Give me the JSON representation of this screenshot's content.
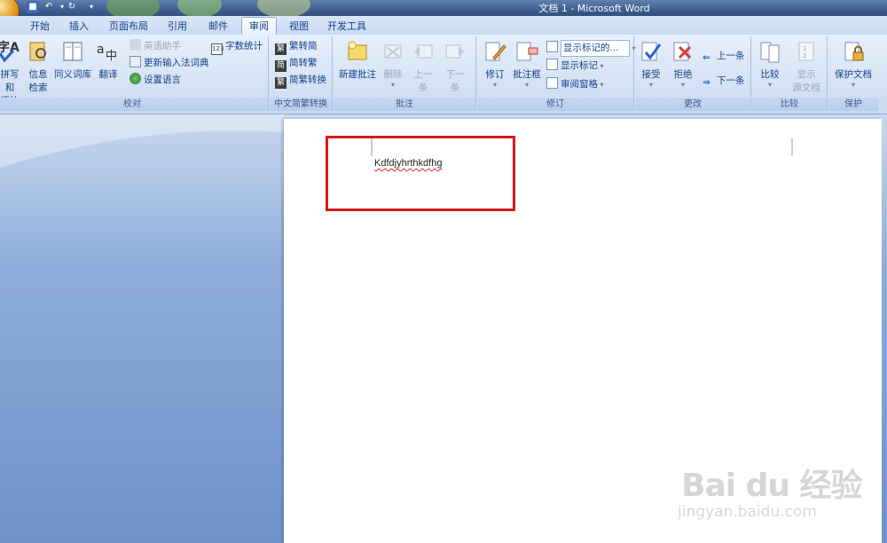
{
  "window": {
    "title": "文档 1 - Microsoft Word"
  },
  "tabs": [
    {
      "label": "开始"
    },
    {
      "label": "插入"
    },
    {
      "label": "页面布局"
    },
    {
      "label": "引用"
    },
    {
      "label": "邮件"
    },
    {
      "label": "审阅",
      "active": true
    },
    {
      "label": "视图"
    },
    {
      "label": "开发工具"
    }
  ],
  "ribbon": {
    "proofing": {
      "label": "校对",
      "spelling_label_1": "拼写和",
      "spelling_label_2": "语法",
      "research_label_1": "信息",
      "research_label_2": "检索",
      "thesaurus_label": "同义词库",
      "translate_label": "翻译",
      "english_assistant": "英语助手",
      "update_ime": "更新输入法词典",
      "set_language": "设置语言",
      "word_count": "字数统计"
    },
    "chinese_conversion": {
      "label": "中文简繁转换",
      "to_simplified": "繁转简",
      "to_traditional": "简转繁",
      "convert": "简繁转换"
    },
    "comments": {
      "label": "批注",
      "new_comment": "新建批注",
      "delete": "删除",
      "previous_1": "上一",
      "previous_2": "条",
      "next_1": "下一",
      "next_2": "条"
    },
    "tracking": {
      "label": "修订",
      "track_changes": "修订",
      "balloons": "批注框",
      "display_dropdown": "显示标记的...",
      "show_markup": "显示标记",
      "reviewing_pane": "审阅窗格"
    },
    "changes": {
      "label": "更改",
      "accept": "接受",
      "reject": "拒绝",
      "previous": "上一条",
      "next": "下一条"
    },
    "compare": {
      "label": "比较",
      "compare": "比较",
      "show_source_1": "显示",
      "show_source_2": "源文档"
    },
    "protect": {
      "label": "保护",
      "protect_document": "保护文档"
    }
  },
  "document": {
    "text": "Kdfdjyhrthkdfhg"
  },
  "watermark": {
    "main": "Bai du 经验",
    "sub": "jingyan.baidu.com"
  },
  "colors": {
    "highlight_box": "#d71920",
    "ribbon_text": "#15428b"
  }
}
